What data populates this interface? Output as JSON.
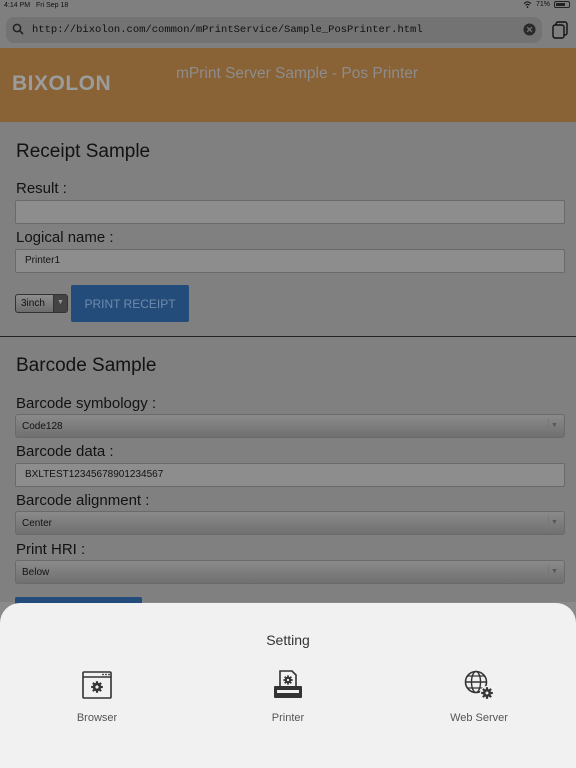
{
  "status_bar": {
    "time": "4:14 PM",
    "date": "Fri Sep 18",
    "battery": "71%",
    "battery_level": 0.71
  },
  "browser": {
    "url": "http://bixolon.com/common/mPrintService/Sample_PosPrinter.html"
  },
  "header": {
    "logo": "BIXOLON",
    "title": "mPrint Server Sample - Pos Printer"
  },
  "receipt": {
    "title": "Receipt Sample",
    "result_label": "Result :",
    "result_value": "",
    "logical_name_label": "Logical name :",
    "logical_name_value": "Printer1",
    "paper_width": "3inch",
    "print_label": "PRINT RECEIPT"
  },
  "barcode": {
    "title": "Barcode Sample",
    "symbology_label": "Barcode symbology :",
    "symbology_value": "Code128",
    "data_label": "Barcode data :",
    "data_value": "BXLTEST12345678901234567",
    "alignment_label": "Barcode alignment :",
    "alignment_value": "Center",
    "hri_label": "Print HRI :",
    "hri_value": "Below"
  },
  "sheet": {
    "title": "Setting",
    "options": [
      {
        "label": "Browser",
        "icon": "browser-settings-icon"
      },
      {
        "label": "Printer",
        "icon": "printer-settings-icon"
      },
      {
        "label": "Web Server",
        "icon": "web-server-settings-icon"
      }
    ]
  }
}
